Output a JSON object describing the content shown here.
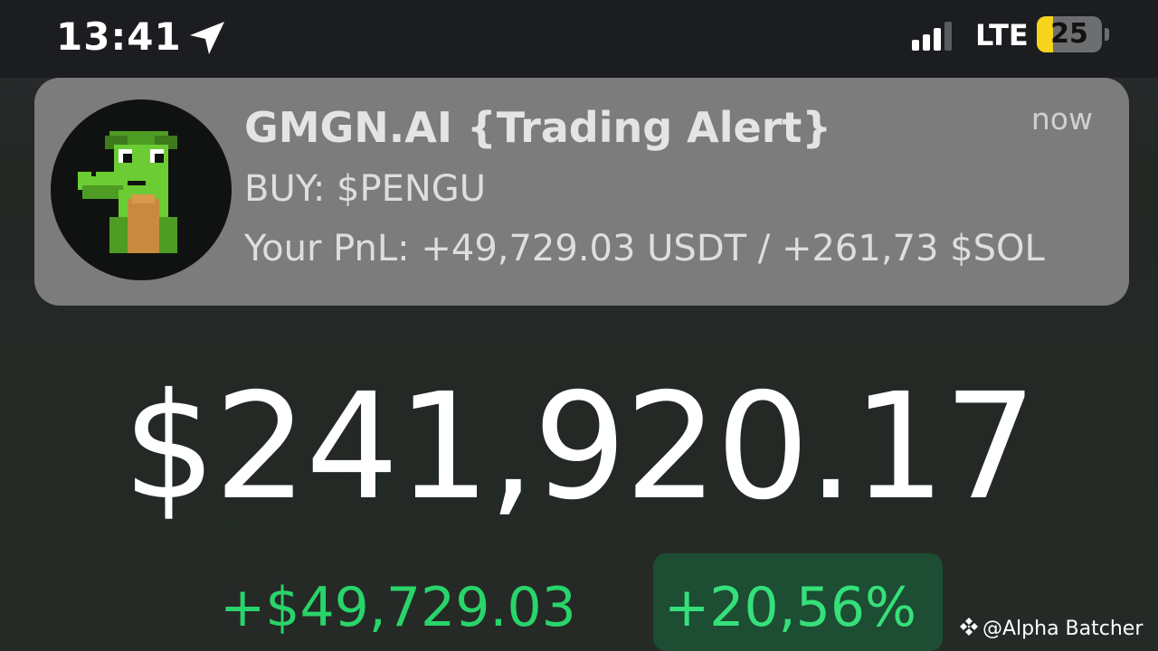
{
  "status_bar": {
    "time": "13:41",
    "location_icon": "location-arrow-icon",
    "signal_icon": "cellular-signal-icon",
    "signal_bars": 3,
    "signal_bars_total": 4,
    "network": "LTE",
    "battery_icon": "battery-icon",
    "battery_level": "25",
    "battery_fraction": 0.25,
    "battery_color": "#f8d31b"
  },
  "notification": {
    "app_icon": "pixel-frog-avatar",
    "title": "GMGN.AI {Trading Alert}",
    "time": "now",
    "line1": "BUY: $PENGU",
    "line2": "Your PnL: +49,729.03 USDT / +261,73 $SOL"
  },
  "portfolio": {
    "balance": "$241,920.17",
    "change_amount": "+$49,729.03",
    "change_percent": "+20,56%",
    "positive_color": "#29d46a"
  },
  "watermark": {
    "icon": "binance-diamond-icon",
    "text": "@Alpha Batcher"
  }
}
